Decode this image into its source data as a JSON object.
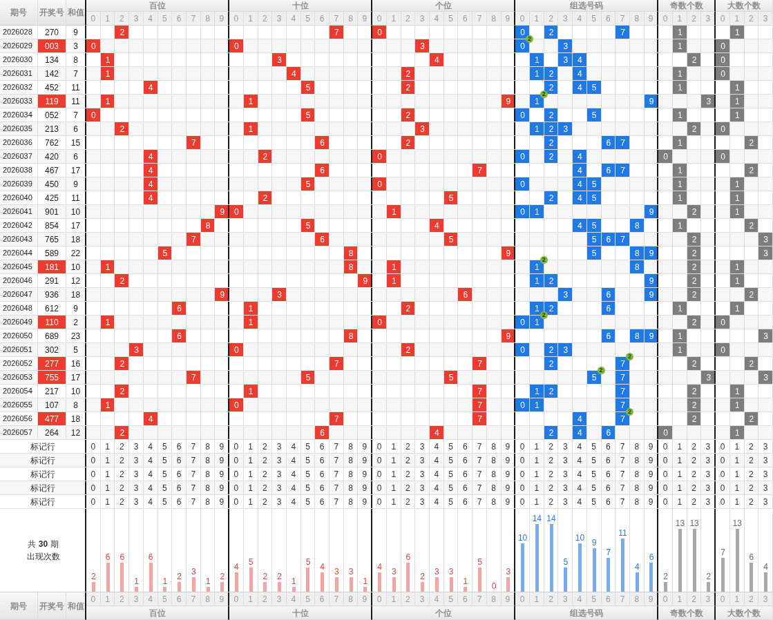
{
  "header": {
    "columns": [
      "期号",
      "开奖号",
      "和值"
    ],
    "sections": [
      {
        "title": "百位",
        "digits": [
          "0",
          "1",
          "2",
          "3",
          "4",
          "5",
          "6",
          "7",
          "8",
          "9"
        ]
      },
      {
        "title": "十位",
        "digits": [
          "0",
          "1",
          "2",
          "3",
          "4",
          "5",
          "6",
          "7",
          "8",
          "9"
        ]
      },
      {
        "title": "个位",
        "digits": [
          "0",
          "1",
          "2",
          "3",
          "4",
          "5",
          "6",
          "7",
          "8",
          "9"
        ]
      },
      {
        "title": "组选号码",
        "digits": [
          "0",
          "1",
          "2",
          "3",
          "4",
          "5",
          "6",
          "7",
          "8",
          "9"
        ]
      },
      {
        "title": "奇数个数",
        "digits": [
          "0",
          "1",
          "2",
          "3"
        ]
      },
      {
        "title": "大数个数",
        "digits": [
          "0",
          "1",
          "2",
          "3"
        ]
      }
    ]
  },
  "rows": [
    {
      "issue": "2026028",
      "number": "270",
      "sum": "9",
      "pair": false,
      "hundreds": "2",
      "tens": "7",
      "units": "0",
      "group": [
        {
          "digit": "0"
        },
        {
          "digit": "2"
        },
        {
          "digit": "7"
        }
      ],
      "odd": "1",
      "big": "1"
    },
    {
      "issue": "2026029",
      "number": "003",
      "sum": "3",
      "pair": true,
      "hundreds": "0",
      "tens": "0",
      "units": "3",
      "group": [
        {
          "digit": "0",
          "badge": "2"
        },
        {
          "digit": "3"
        }
      ],
      "odd": "1",
      "big": "0"
    },
    {
      "issue": "2026030",
      "number": "134",
      "sum": "8",
      "pair": false,
      "hundreds": "1",
      "tens": "3",
      "units": "4",
      "group": [
        {
          "digit": "1"
        },
        {
          "digit": "3"
        },
        {
          "digit": "4"
        }
      ],
      "odd": "2",
      "big": "0"
    },
    {
      "issue": "2026031",
      "number": "142",
      "sum": "7",
      "pair": false,
      "hundreds": "1",
      "tens": "4",
      "units": "2",
      "group": [
        {
          "digit": "1"
        },
        {
          "digit": "2"
        },
        {
          "digit": "4"
        }
      ],
      "odd": "1",
      "big": "0"
    },
    {
      "issue": "2026032",
      "number": "452",
      "sum": "11",
      "pair": false,
      "hundreds": "4",
      "tens": "5",
      "units": "2",
      "group": [
        {
          "digit": "2"
        },
        {
          "digit": "4"
        },
        {
          "digit": "5"
        }
      ],
      "odd": "1",
      "big": "1"
    },
    {
      "issue": "2026033",
      "number": "119",
      "sum": "11",
      "pair": true,
      "hundreds": "1",
      "tens": "1",
      "units": "9",
      "group": [
        {
          "digit": "1",
          "badge": "2"
        },
        {
          "digit": "9"
        }
      ],
      "odd": "3",
      "big": "1"
    },
    {
      "issue": "2026034",
      "number": "052",
      "sum": "7",
      "pair": false,
      "hundreds": "0",
      "tens": "5",
      "units": "2",
      "group": [
        {
          "digit": "0"
        },
        {
          "digit": "2"
        },
        {
          "digit": "5"
        }
      ],
      "odd": "1",
      "big": "1"
    },
    {
      "issue": "2026035",
      "number": "213",
      "sum": "6",
      "pair": false,
      "hundreds": "2",
      "tens": "1",
      "units": "3",
      "group": [
        {
          "digit": "1"
        },
        {
          "digit": "2"
        },
        {
          "digit": "3"
        }
      ],
      "odd": "2",
      "big": "0"
    },
    {
      "issue": "2026036",
      "number": "762",
      "sum": "15",
      "pair": false,
      "hundreds": "7",
      "tens": "6",
      "units": "2",
      "group": [
        {
          "digit": "2"
        },
        {
          "digit": "6"
        },
        {
          "digit": "7"
        }
      ],
      "odd": "1",
      "big": "2"
    },
    {
      "issue": "2026037",
      "number": "420",
      "sum": "6",
      "pair": false,
      "hundreds": "4",
      "tens": "2",
      "units": "0",
      "group": [
        {
          "digit": "0"
        },
        {
          "digit": "2"
        },
        {
          "digit": "4"
        }
      ],
      "odd": "0",
      "big": "0"
    },
    {
      "issue": "2026038",
      "number": "467",
      "sum": "17",
      "pair": false,
      "hundreds": "4",
      "tens": "6",
      "units": "7",
      "group": [
        {
          "digit": "4"
        },
        {
          "digit": "6"
        },
        {
          "digit": "7"
        }
      ],
      "odd": "1",
      "big": "2"
    },
    {
      "issue": "2026039",
      "number": "450",
      "sum": "9",
      "pair": false,
      "hundreds": "4",
      "tens": "5",
      "units": "0",
      "group": [
        {
          "digit": "0"
        },
        {
          "digit": "4"
        },
        {
          "digit": "5"
        }
      ],
      "odd": "1",
      "big": "1"
    },
    {
      "issue": "2026040",
      "number": "425",
      "sum": "11",
      "pair": false,
      "hundreds": "4",
      "tens": "2",
      "units": "5",
      "group": [
        {
          "digit": "2"
        },
        {
          "digit": "4"
        },
        {
          "digit": "5"
        }
      ],
      "odd": "1",
      "big": "1"
    },
    {
      "issue": "2026041",
      "number": "901",
      "sum": "10",
      "pair": false,
      "hundreds": "9",
      "tens": "0",
      "units": "1",
      "group": [
        {
          "digit": "0"
        },
        {
          "digit": "1"
        },
        {
          "digit": "9"
        }
      ],
      "odd": "2",
      "big": "1"
    },
    {
      "issue": "2026042",
      "number": "854",
      "sum": "17",
      "pair": false,
      "hundreds": "8",
      "tens": "5",
      "units": "4",
      "group": [
        {
          "digit": "4"
        },
        {
          "digit": "5"
        },
        {
          "digit": "8"
        }
      ],
      "odd": "1",
      "big": "2"
    },
    {
      "issue": "2026043",
      "number": "765",
      "sum": "18",
      "pair": false,
      "hundreds": "7",
      "tens": "6",
      "units": "5",
      "group": [
        {
          "digit": "5"
        },
        {
          "digit": "6"
        },
        {
          "digit": "7"
        }
      ],
      "odd": "2",
      "big": "3"
    },
    {
      "issue": "2026044",
      "number": "589",
      "sum": "22",
      "pair": false,
      "hundreds": "5",
      "tens": "8",
      "units": "9",
      "group": [
        {
          "digit": "5"
        },
        {
          "digit": "8"
        },
        {
          "digit": "9"
        }
      ],
      "odd": "2",
      "big": "3"
    },
    {
      "issue": "2026045",
      "number": "181",
      "sum": "10",
      "pair": true,
      "hundreds": "1",
      "tens": "8",
      "units": "1",
      "group": [
        {
          "digit": "1",
          "badge": "2"
        },
        {
          "digit": "8"
        }
      ],
      "odd": "2",
      "big": "1"
    },
    {
      "issue": "2026046",
      "number": "291",
      "sum": "12",
      "pair": false,
      "hundreds": "2",
      "tens": "9",
      "units": "1",
      "group": [
        {
          "digit": "1"
        },
        {
          "digit": "2"
        },
        {
          "digit": "9"
        }
      ],
      "odd": "2",
      "big": "1"
    },
    {
      "issue": "2026047",
      "number": "936",
      "sum": "18",
      "pair": false,
      "hundreds": "9",
      "tens": "3",
      "units": "6",
      "group": [
        {
          "digit": "3"
        },
        {
          "digit": "6"
        },
        {
          "digit": "9"
        }
      ],
      "odd": "2",
      "big": "2"
    },
    {
      "issue": "2026048",
      "number": "612",
      "sum": "9",
      "pair": false,
      "hundreds": "6",
      "tens": "1",
      "units": "2",
      "group": [
        {
          "digit": "1"
        },
        {
          "digit": "2"
        },
        {
          "digit": "6"
        }
      ],
      "odd": "1",
      "big": "1"
    },
    {
      "issue": "2026049",
      "number": "110",
      "sum": "2",
      "pair": true,
      "hundreds": "1",
      "tens": "1",
      "units": "0",
      "group": [
        {
          "digit": "0"
        },
        {
          "digit": "1",
          "badge": "2"
        }
      ],
      "odd": "2",
      "big": "0"
    },
    {
      "issue": "2026050",
      "number": "689",
      "sum": "23",
      "pair": false,
      "hundreds": "6",
      "tens": "8",
      "units": "9",
      "group": [
        {
          "digit": "6"
        },
        {
          "digit": "8"
        },
        {
          "digit": "9"
        }
      ],
      "odd": "1",
      "big": "3"
    },
    {
      "issue": "2026051",
      "number": "302",
      "sum": "5",
      "pair": false,
      "hundreds": "3",
      "tens": "0",
      "units": "2",
      "group": [
        {
          "digit": "0"
        },
        {
          "digit": "2"
        },
        {
          "digit": "3"
        }
      ],
      "odd": "1",
      "big": "0"
    },
    {
      "issue": "2026052",
      "number": "277",
      "sum": "16",
      "pair": true,
      "hundreds": "2",
      "tens": "7",
      "units": "7",
      "group": [
        {
          "digit": "2"
        },
        {
          "digit": "7",
          "badge": "2"
        }
      ],
      "odd": "2",
      "big": "2"
    },
    {
      "issue": "2026053",
      "number": "755",
      "sum": "17",
      "pair": true,
      "hundreds": "7",
      "tens": "5",
      "units": "5",
      "group": [
        {
          "digit": "5",
          "badge": "2"
        },
        {
          "digit": "7"
        }
      ],
      "odd": "3",
      "big": "3"
    },
    {
      "issue": "2026054",
      "number": "217",
      "sum": "10",
      "pair": false,
      "hundreds": "2",
      "tens": "1",
      "units": "7",
      "group": [
        {
          "digit": "1"
        },
        {
          "digit": "2"
        },
        {
          "digit": "7"
        }
      ],
      "odd": "2",
      "big": "1"
    },
    {
      "issue": "2026055",
      "number": "107",
      "sum": "8",
      "pair": false,
      "hundreds": "1",
      "tens": "0",
      "units": "7",
      "group": [
        {
          "digit": "0"
        },
        {
          "digit": "1"
        },
        {
          "digit": "7"
        }
      ],
      "odd": "2",
      "big": "1"
    },
    {
      "issue": "2026056",
      "number": "477",
      "sum": "18",
      "pair": true,
      "hundreds": "4",
      "tens": "7",
      "units": "7",
      "group": [
        {
          "digit": "4"
        },
        {
          "digit": "7",
          "badge": "2"
        }
      ],
      "odd": "2",
      "big": "2"
    },
    {
      "issue": "2026057",
      "number": "264",
      "sum": "12",
      "pair": false,
      "hundreds": "2",
      "tens": "6",
      "units": "4",
      "group": [
        {
          "digit": "2"
        },
        {
          "digit": "4"
        },
        {
          "digit": "6"
        }
      ],
      "odd": "0",
      "big": "1"
    }
  ],
  "marker_rows": [
    {
      "label": "标记行",
      "sections": [
        [
          "0",
          "1",
          "2",
          "3",
          "4",
          "5",
          "6",
          "7",
          "8",
          "9"
        ],
        [
          "0",
          "1",
          "2",
          "3",
          "4",
          "5",
          "6",
          "7",
          "8",
          "9"
        ],
        [
          "0",
          "1",
          "2",
          "3",
          "4",
          "5",
          "6",
          "7",
          "8",
          "9"
        ],
        [
          "0",
          "1",
          "2",
          "3",
          "4",
          "5",
          "6",
          "7",
          "8",
          "9"
        ],
        [
          "0",
          "1",
          "2",
          "3"
        ],
        [
          "0",
          "1",
          "2",
          "3"
        ]
      ]
    },
    {
      "label": "标记行",
      "sections": [
        [
          "0",
          "1",
          "2",
          "3",
          "4",
          "5",
          "6",
          "7",
          "8",
          "9"
        ],
        [
          "0",
          "1",
          "2",
          "3",
          "4",
          "5",
          "6",
          "7",
          "8",
          "9"
        ],
        [
          "0",
          "1",
          "2",
          "3",
          "4",
          "5",
          "6",
          "7",
          "8",
          "9"
        ],
        [
          "0",
          "1",
          "2",
          "3",
          "4",
          "5",
          "6",
          "7",
          "8",
          "9"
        ],
        [
          "0",
          "1",
          "2",
          "3"
        ],
        [
          "0",
          "1",
          "2",
          "3"
        ]
      ]
    },
    {
      "label": "标记行",
      "sections": [
        [
          "0",
          "1",
          "2",
          "3",
          "4",
          "5",
          "6",
          "7",
          "8",
          "9"
        ],
        [
          "0",
          "1",
          "2",
          "3",
          "4",
          "5",
          "6",
          "7",
          "8",
          "9"
        ],
        [
          "0",
          "1",
          "2",
          "3",
          "4",
          "5",
          "6",
          "7",
          "8",
          "9"
        ],
        [
          "0",
          "1",
          "2",
          "3",
          "4",
          "5",
          "6",
          "7",
          "8",
          "9"
        ],
        [
          "0",
          "1",
          "2",
          "3"
        ],
        [
          "0",
          "1",
          "2",
          "3"
        ]
      ]
    },
    {
      "label": "标记行",
      "sections": [
        [
          "0",
          "1",
          "2",
          "3",
          "4",
          "5",
          "6",
          "7",
          "8",
          "9"
        ],
        [
          "0",
          "1",
          "2",
          "3",
          "4",
          "5",
          "6",
          "7",
          "8",
          "9"
        ],
        [
          "0",
          "1",
          "2",
          "3",
          "4",
          "5",
          "6",
          "7",
          "8",
          "9"
        ],
        [
          "0",
          "1",
          "2",
          "3",
          "4",
          "5",
          "6",
          "7",
          "8",
          "9"
        ],
        [
          "0",
          "1",
          "2",
          "3"
        ],
        [
          "0",
          "1",
          "2",
          "3"
        ]
      ]
    },
    {
      "label": "标记行",
      "sections": [
        [
          "0",
          "1",
          "2",
          "3",
          "4",
          "5",
          "6",
          "7",
          "8",
          "9"
        ],
        [
          "0",
          "1",
          "2",
          "3",
          "4",
          "5",
          "6",
          "7",
          "8",
          "9"
        ],
        [
          "0",
          "1",
          "2",
          "3",
          "4",
          "5",
          "6",
          "7",
          "8",
          "9"
        ],
        [
          "0",
          "1",
          "2",
          "3",
          "4",
          "5",
          "6",
          "7",
          "8",
          "9"
        ],
        [
          "0",
          "1",
          "2",
          "3"
        ],
        [
          "0",
          "1",
          "2",
          "3"
        ]
      ]
    }
  ],
  "counts": {
    "label": "共 **30** 期",
    "sublabel": "出现次数",
    "sections": [
      {
        "kind": "position",
        "values": [
          "2",
          "6",
          "6",
          "1",
          "6",
          "1",
          "2",
          "3",
          "1",
          "2"
        ]
      },
      {
        "kind": "position",
        "values": [
          "4",
          "5",
          "2",
          "2",
          "1",
          "5",
          "4",
          "3",
          "3",
          "1"
        ]
      },
      {
        "kind": "position",
        "values": [
          "4",
          "3",
          "6",
          "2",
          "3",
          "3",
          "1",
          "5",
          "0",
          "3"
        ]
      },
      {
        "kind": "group",
        "values": [
          "10",
          "14",
          "14",
          "5",
          "10",
          "9",
          "7",
          "11",
          "4",
          "6"
        ]
      },
      {
        "kind": "tally",
        "values": [
          "2",
          "13",
          "13",
          "2"
        ]
      },
      {
        "kind": "tally",
        "values": [
          "7",
          "13",
          "6",
          "4"
        ]
      }
    ]
  },
  "footer": {
    "columns": [
      "期号",
      "开奖号",
      "和值"
    ],
    "sections": [
      {
        "title": "百位",
        "digits": [
          "0",
          "1",
          "2",
          "3",
          "4",
          "5",
          "6",
          "7",
          "8",
          "9"
        ]
      },
      {
        "title": "十位",
        "digits": [
          "0",
          "1",
          "2",
          "3",
          "4",
          "5",
          "6",
          "7",
          "8",
          "9"
        ]
      },
      {
        "title": "个位",
        "digits": [
          "0",
          "1",
          "2",
          "3",
          "4",
          "5",
          "6",
          "7",
          "8",
          "9"
        ]
      },
      {
        "title": "组选号码",
        "digits": [
          "0",
          "1",
          "2",
          "3",
          "4",
          "5",
          "6",
          "7",
          "8",
          "9"
        ]
      },
      {
        "title": "奇数个数",
        "digits": [
          "0",
          "1",
          "2",
          "3"
        ]
      },
      {
        "title": "大数个数",
        "digits": [
          "0",
          "1",
          "2",
          "3"
        ]
      }
    ]
  }
}
